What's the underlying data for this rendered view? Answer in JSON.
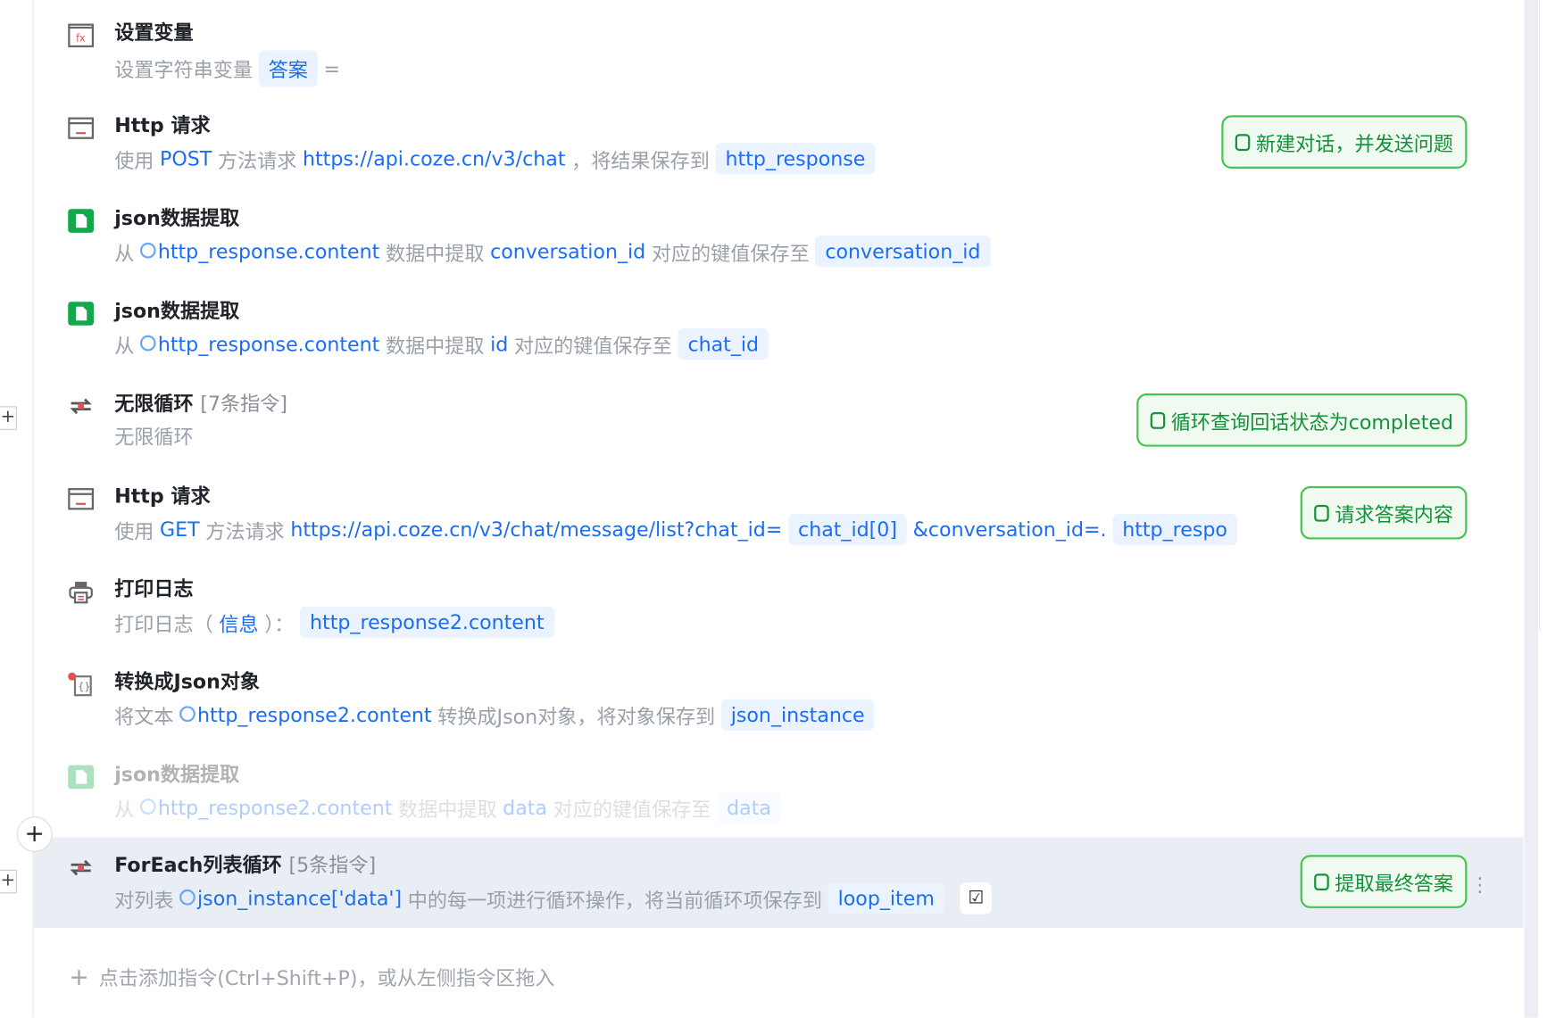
{
  "steps": [
    {
      "title": "设置变量",
      "desc_prefix": "设置字符串变量",
      "var": "答案",
      "suffix": "="
    },
    {
      "title": "Http 请求",
      "pre": "使用",
      "method": "POST",
      "mid": "方法请求",
      "url": "https://api.coze.cn/v3/chat",
      "sep": "，将结果保存到",
      "var": "http_response",
      "note": "新建对话，并发送问题"
    },
    {
      "title": "json数据提取",
      "from": "从",
      "src": "http_response.content",
      "mid": "数据中提取",
      "key": "conversation_id",
      "save": "对应的键值保存至",
      "var": "conversation_id"
    },
    {
      "title": "json数据提取",
      "from": "从",
      "src": "http_response.content",
      "mid": "数据中提取",
      "key": "id",
      "save": "对应的键值保存至",
      "var": "chat_id"
    },
    {
      "title": "无限循环",
      "count": "[7条指令]",
      "desc": "无限循环",
      "note": "循环查询回话状态为completed"
    },
    {
      "title": "Http 请求",
      "pre": "使用",
      "method": "GET",
      "mid": "方法请求",
      "url": "https://api.coze.cn/v3/chat/message/list?chat_id=",
      "var1": "chat_id[0]",
      "url2": "&conversation_id=.",
      "var2": "http_respo",
      "note": "请求答案内容"
    },
    {
      "title": "打印日志",
      "pre": "打印日志（",
      "level": "信息",
      "post": "）：",
      "var": "http_response2.content"
    },
    {
      "title": "转换成Json对象",
      "pre": "将文本",
      "src": "http_response2.content",
      "mid": "转换成Json对象，将对象保存到",
      "var": "json_instance"
    },
    {
      "title": "json数据提取",
      "from": "从",
      "src": "http_response2.content",
      "mid": "数据中提取",
      "key": "data",
      "save": "对应的键值保存至",
      "var": "data"
    },
    {
      "title": "ForEach列表循环",
      "count": "[5条指令]",
      "pre": "对列表",
      "src": "json_instance['data']",
      "mid": "中的每一项进行循环操作，将当前循环项保存到",
      "var": "loop_item",
      "note": "提取最终答案"
    }
  ],
  "add_hint": "点击添加指令(Ctrl+Shift+P)，或从左侧指令区拖入",
  "plus": "+",
  "more": "⋮"
}
